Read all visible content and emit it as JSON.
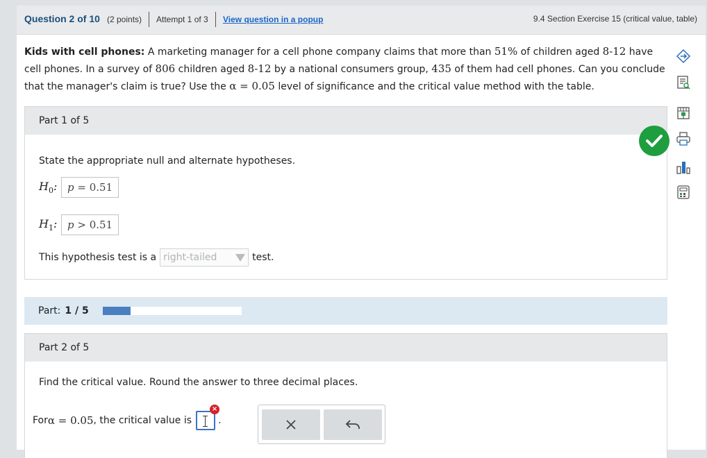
{
  "header": {
    "question_label": "Question 2 of 10",
    "points": "(2 points)",
    "attempt": "Attempt 1 of 3",
    "popup_link": "View question in a popup",
    "section": "9.4 Section Exercise 15 (critical value, table)"
  },
  "question": {
    "title": "Kids with cell phones:",
    "t1": " A marketing manager for a cell phone company claims that more than ",
    "m1": "51%",
    "t2": " of children aged ",
    "m2": "8-12",
    "t3": " have cell phones. In a survey of ",
    "m3": "806",
    "t4": " children aged ",
    "m4": "8-12",
    "t5": " by a national consumers group, ",
    "m5": "435",
    "t6": " of them had cell phones. Can you conclude that the manager's claim is true? Use the ",
    "m6": "α = 0.05",
    "t7": " level of significance and the critical value method with the table."
  },
  "toolbar": {
    "icons": [
      "move-icon",
      "document-search-icon",
      "table-icon",
      "print-icon",
      "bar-chart-icon",
      "calculator-icon"
    ]
  },
  "part1": {
    "header": "Part 1 of 5",
    "instruction": "State the appropriate null and alternate hypotheses.",
    "h0_label_main": "H",
    "h0_label_sub": "0",
    "h0_var": "p",
    "h0_rest": " = 0.51",
    "h1_label_main": "H",
    "h1_label_sub": "1",
    "h1_var": "p",
    "h1_rest": " > 0.51",
    "tail_prefix": "This hypothesis test is a",
    "tail_value": "right-tailed",
    "tail_suffix": "test.",
    "status": "correct"
  },
  "progress": {
    "label": "Part:",
    "value": "1 / 5",
    "fraction": 0.2,
    "color": "#4a7fc0"
  },
  "part2": {
    "header": "Part 2 of 5",
    "instruction": "Find the critical value. Round the answer to three decimal places.",
    "crit_prefix": "For ",
    "crit_math": "α = 0.05",
    "crit_middle": ", the critical value is",
    "crit_input_value": "",
    "crit_suffix": ".",
    "error_mark": "×",
    "keypad": [
      "clear-icon",
      "undo-icon"
    ]
  },
  "colors": {
    "accent_link": "#1a66c9",
    "header_text": "#1d4f7d",
    "success": "#1e9e3e",
    "error": "#d72027"
  }
}
